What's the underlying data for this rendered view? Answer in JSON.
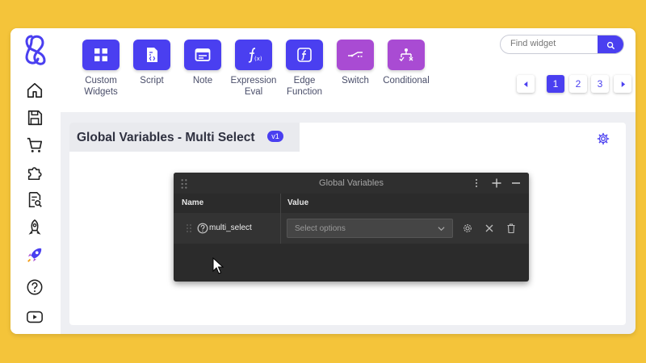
{
  "toolbar": {
    "widgets": [
      {
        "label": "Custom\nWidgets",
        "icon": "grid-icon",
        "color": "#4a3ff0"
      },
      {
        "label": "Script",
        "icon": "script-file-icon",
        "color": "#4a3ff0"
      },
      {
        "label": "Note",
        "icon": "note-icon",
        "color": "#4a3ff0"
      },
      {
        "label": "Expression\nEval",
        "icon": "function-icon",
        "color": "#4a3ff0"
      },
      {
        "label": "Edge\nFunction",
        "icon": "edge-function-icon",
        "color": "#4a3ff0"
      },
      {
        "label": "Switch",
        "icon": "switch-icon",
        "color": "#a94bd3"
      },
      {
        "label": "Conditional",
        "icon": "conditional-icon",
        "color": "#a94bd3"
      }
    ],
    "search_placeholder": "Find widget",
    "pages": [
      "1",
      "2",
      "3"
    ],
    "active_page": "1"
  },
  "sidebar": {
    "items": [
      "logo-icon",
      "home-icon",
      "save-icon",
      "cart-icon",
      "puzzle-icon",
      "document-search-icon",
      "rocket-outline-icon",
      "rocket-active-icon",
      "help-icon",
      "youtube-icon"
    ]
  },
  "canvas": {
    "title": "Global Variables - Multi Select",
    "version": "v1"
  },
  "panel": {
    "title": "Global Variables",
    "col_name": "Name",
    "col_value": "Value",
    "var_name": "multi_select",
    "select_placeholder": "Select options"
  },
  "colors": {
    "background": "#f4c43a",
    "accent": "#4a3ff0",
    "purple": "#a94bd3"
  }
}
